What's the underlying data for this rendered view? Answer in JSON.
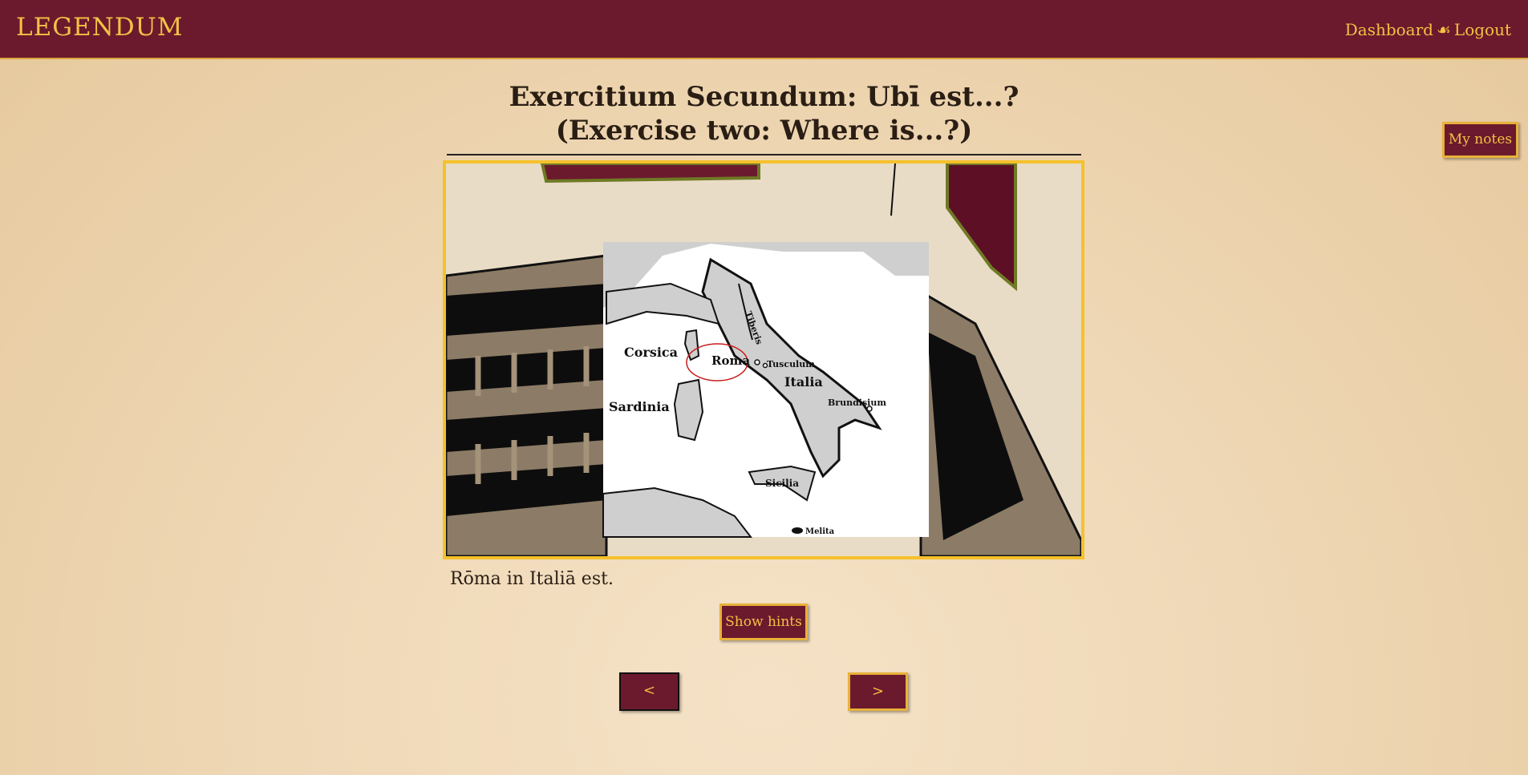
{
  "header": {
    "logo": "LEGENDUM",
    "nav": {
      "dashboard": "Dashboard",
      "separator": "☙",
      "logout": "Logout"
    }
  },
  "exercise": {
    "title": "Exercitium Secundum: Ubī est...? (Exercise two: Where is...?)",
    "caption": "Rōma in Italiā est."
  },
  "map": {
    "labels": {
      "corsica": "Corsica",
      "sardinia": "Sardinia",
      "roma": "Roma",
      "tiberis": "Tiberis",
      "tusculum": "Tusculum",
      "italia": "Italia",
      "brundisium": "Brundisium",
      "sicilia": "Sicilia",
      "melita": "Melita"
    }
  },
  "buttons": {
    "my_notes": "My notes",
    "show_hints": "Show hints",
    "prev": "<",
    "next": ">"
  },
  "colors": {
    "primary": "#6b1a2d",
    "accent": "#f3c144",
    "frame": "#f5c12c"
  }
}
